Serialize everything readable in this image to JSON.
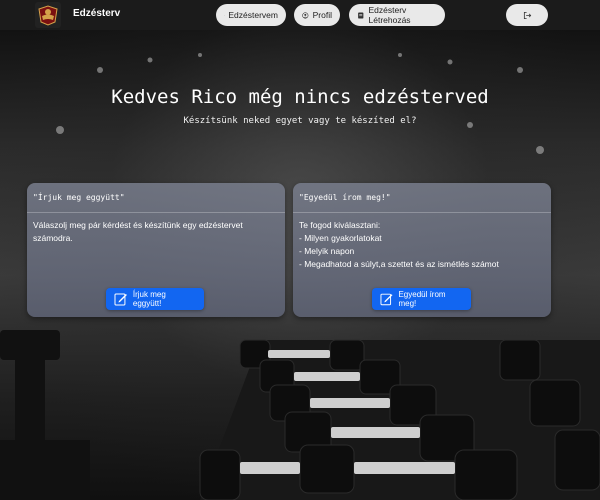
{
  "navbar": {
    "brand": "Edzésterv",
    "buttons": {
      "plans": "Edzéstervem",
      "profile": "Profil",
      "create": "Edzésterv Létrehozás"
    }
  },
  "hero": {
    "title": "Kedves Rico még nincs edzésterved",
    "subtitle": "Készítsünk neked egyet vagy te készíted el?"
  },
  "cards": {
    "together": {
      "header": "\"Írjuk meg eggyütt\"",
      "body": "Válaszolj meg pár kérdést és készítünk egy edzéstervet számodra.",
      "button": "Írjuk meg eggyütt!"
    },
    "alone": {
      "header": "\"Egyedül írom meg!\"",
      "intro": "Te fogod kiválasztani:",
      "items": [
        "- Milyen gyakorlatokat",
        "- Melyik napon",
        "- Megadhatod a súlyt,a szettet és az ismétlés számot"
      ],
      "button": "Egyedül írom meg!"
    }
  },
  "colors": {
    "navbar": "#1b1b1b",
    "nav_button": "#e9e9e9",
    "primary_button": "#1266f1"
  }
}
